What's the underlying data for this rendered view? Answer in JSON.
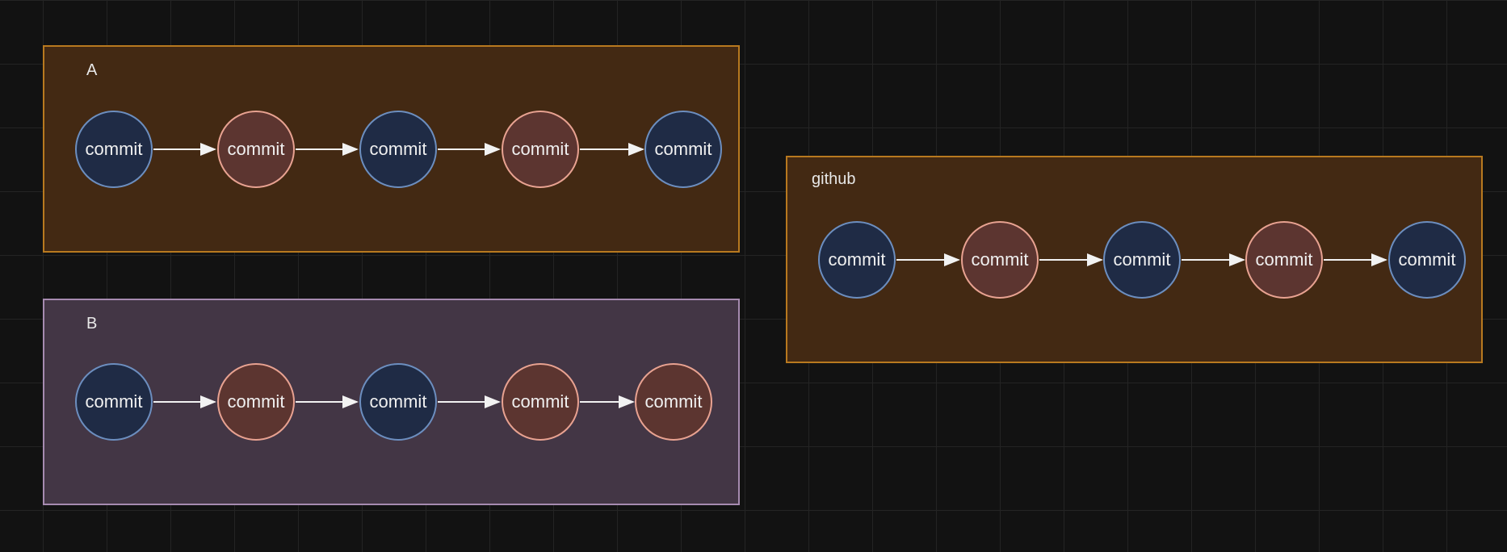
{
  "containers": [
    {
      "label": "A",
      "fill": "#432913",
      "border": "#b8791f"
    },
    {
      "label": "B",
      "fill": "#433645",
      "border": "#a68bb0"
    },
    {
      "label": "github",
      "fill": "#432913",
      "border": "#b8791f"
    }
  ],
  "nodes": {
    "A": [
      {
        "label": "commit",
        "color": "blue"
      },
      {
        "label": "commit",
        "color": "red"
      },
      {
        "label": "commit",
        "color": "blue"
      },
      {
        "label": "commit",
        "color": "red"
      },
      {
        "label": "commit",
        "color": "blue"
      }
    ],
    "B": [
      {
        "label": "commit",
        "color": "blue"
      },
      {
        "label": "commit",
        "color": "red"
      },
      {
        "label": "commit",
        "color": "blue"
      },
      {
        "label": "commit",
        "color": "red"
      },
      {
        "label": "commit",
        "color": "red"
      }
    ],
    "github": [
      {
        "label": "commit",
        "color": "blue"
      },
      {
        "label": "commit",
        "color": "red"
      },
      {
        "label": "commit",
        "color": "blue"
      },
      {
        "label": "commit",
        "color": "red"
      },
      {
        "label": "commit",
        "color": "blue"
      }
    ]
  },
  "colors": {
    "commit_blue_fill": "#1f2b45",
    "commit_blue_border": "#6c8ebf",
    "commit_red_fill": "#5c3530",
    "commit_red_border": "#e8a291",
    "arrow": "#f2f2f2",
    "canvas": "#121212"
  }
}
